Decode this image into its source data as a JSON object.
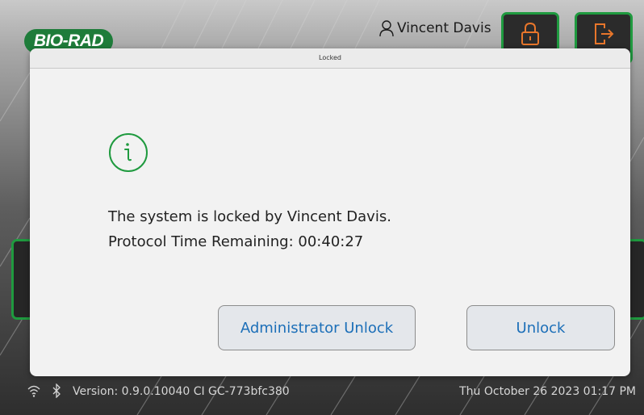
{
  "header": {
    "logo_text": "BIO-RAD",
    "user_name": "Vincent Davis",
    "icons": [
      "user-icon",
      "lock-icon",
      "logout-icon"
    ]
  },
  "dialog": {
    "title": "Locked",
    "icon": "info-icon",
    "message_line1": "The system is locked by Vincent Davis.",
    "message_line2": "Protocol Time Remaining: 00:40:27",
    "admin_unlock_label": "Administrator Unlock",
    "unlock_label": "Unlock"
  },
  "status_bar": {
    "icons": [
      "wifi-icon",
      "bluetooth-icon"
    ],
    "version": "Version: 0.9.0.10040 CI GC-773bfc380",
    "datetime": "Thu October 26 2023 01:17 PM"
  },
  "colors": {
    "accent_green": "#1f9a3f",
    "link_blue": "#1c6fb8",
    "dialog_bg": "#f2f2f2",
    "logo_green": "#1e7c3a"
  }
}
